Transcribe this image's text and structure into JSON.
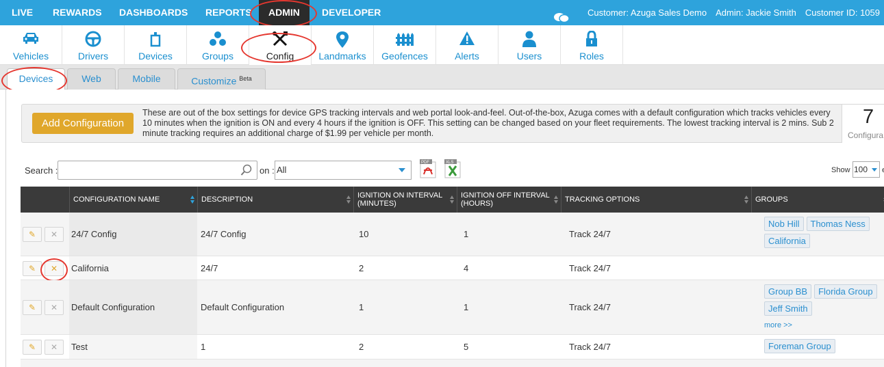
{
  "topnav": {
    "items": [
      "LIVE",
      "REWARDS",
      "DASHBOARDS",
      "REPORTS",
      "ADMIN",
      "DEVELOPER"
    ],
    "customer": "Customer: Azuga Sales Demo",
    "admin": "Admin: Jackie Smith",
    "customer_id": "Customer ID: 1059"
  },
  "iconbar": {
    "items": [
      {
        "label": "Vehicles",
        "icon": "car-icon"
      },
      {
        "label": "Drivers",
        "icon": "steering-wheel-icon"
      },
      {
        "label": "Devices",
        "icon": "device-icon"
      },
      {
        "label": "Groups",
        "icon": "groups-icon"
      },
      {
        "label": "Config",
        "icon": "wrench-screwdriver-icon"
      },
      {
        "label": "Landmarks",
        "icon": "map-pin-icon"
      },
      {
        "label": "Geofences",
        "icon": "fence-icon"
      },
      {
        "label": "Alerts",
        "icon": "warning-icon"
      },
      {
        "label": "Users",
        "icon": "user-icon"
      },
      {
        "label": "Roles",
        "icon": "lock-icon"
      }
    ]
  },
  "subtabs": {
    "devices": "Devices",
    "web": "Web",
    "mobile": "Mobile",
    "customize": "Customize",
    "beta": "Beta"
  },
  "info": {
    "add_button": "Add Configuration",
    "text": "These are out of the box settings for device GPS tracking intervals and web portal look-and-feel. Out-of-the-box, Azuga comes with a default configuration which tracks vehicles every 10 minutes when the ignition is ON and every 4 hours if the ignition is OFF. This setting can be changed based on your fleet requirements. The lowest tracking interval is 2 mins. Sub 2 minute tracking requires an additional charge of $1.99 per vehicle per month.",
    "count": "7",
    "count_label": "Configura"
  },
  "search": {
    "label": "Search :",
    "value": "",
    "on_label": "on :",
    "on_value": "All",
    "show_label": "Show",
    "show_value": "100",
    "show_suffix": "e"
  },
  "table": {
    "headers": [
      "CONFIGURATION NAME",
      "DESCRIPTION",
      "IGNITION ON INTERVAL (MINUTES)",
      "IGNITION OFF INTERVAL (HOURS)",
      "TRACKING OPTIONS",
      "GROUPS"
    ],
    "rows": [
      {
        "name": "24/7 Config",
        "description": "24/7 Config",
        "on": "10",
        "off": "1",
        "tracking": "Track 24/7",
        "groups": [
          "Nob Hill",
          "Thomas Ness",
          "California"
        ],
        "more": ""
      },
      {
        "name": "California",
        "description": "24/7",
        "on": "2",
        "off": "4",
        "tracking": "Track 24/7",
        "groups": [],
        "more": ""
      },
      {
        "name": "Default Configuration",
        "description": "Default Configuration",
        "on": "1",
        "off": "1",
        "tracking": "Track 24/7",
        "groups": [
          "Group BB",
          "Florida Group",
          "Jeff Smith"
        ],
        "more": "more >>"
      },
      {
        "name": "Test",
        "description": "1",
        "on": "2",
        "off": "5",
        "tracking": "Track 24/7",
        "groups": [
          "Foreman Group"
        ],
        "more": ""
      }
    ]
  },
  "colors": {
    "topnav": "#2ea3dc",
    "active_nav": "#2b2b2b",
    "accent_button": "#e0a72b",
    "link": "#2a8fcf",
    "annotation": "#e5372f"
  }
}
